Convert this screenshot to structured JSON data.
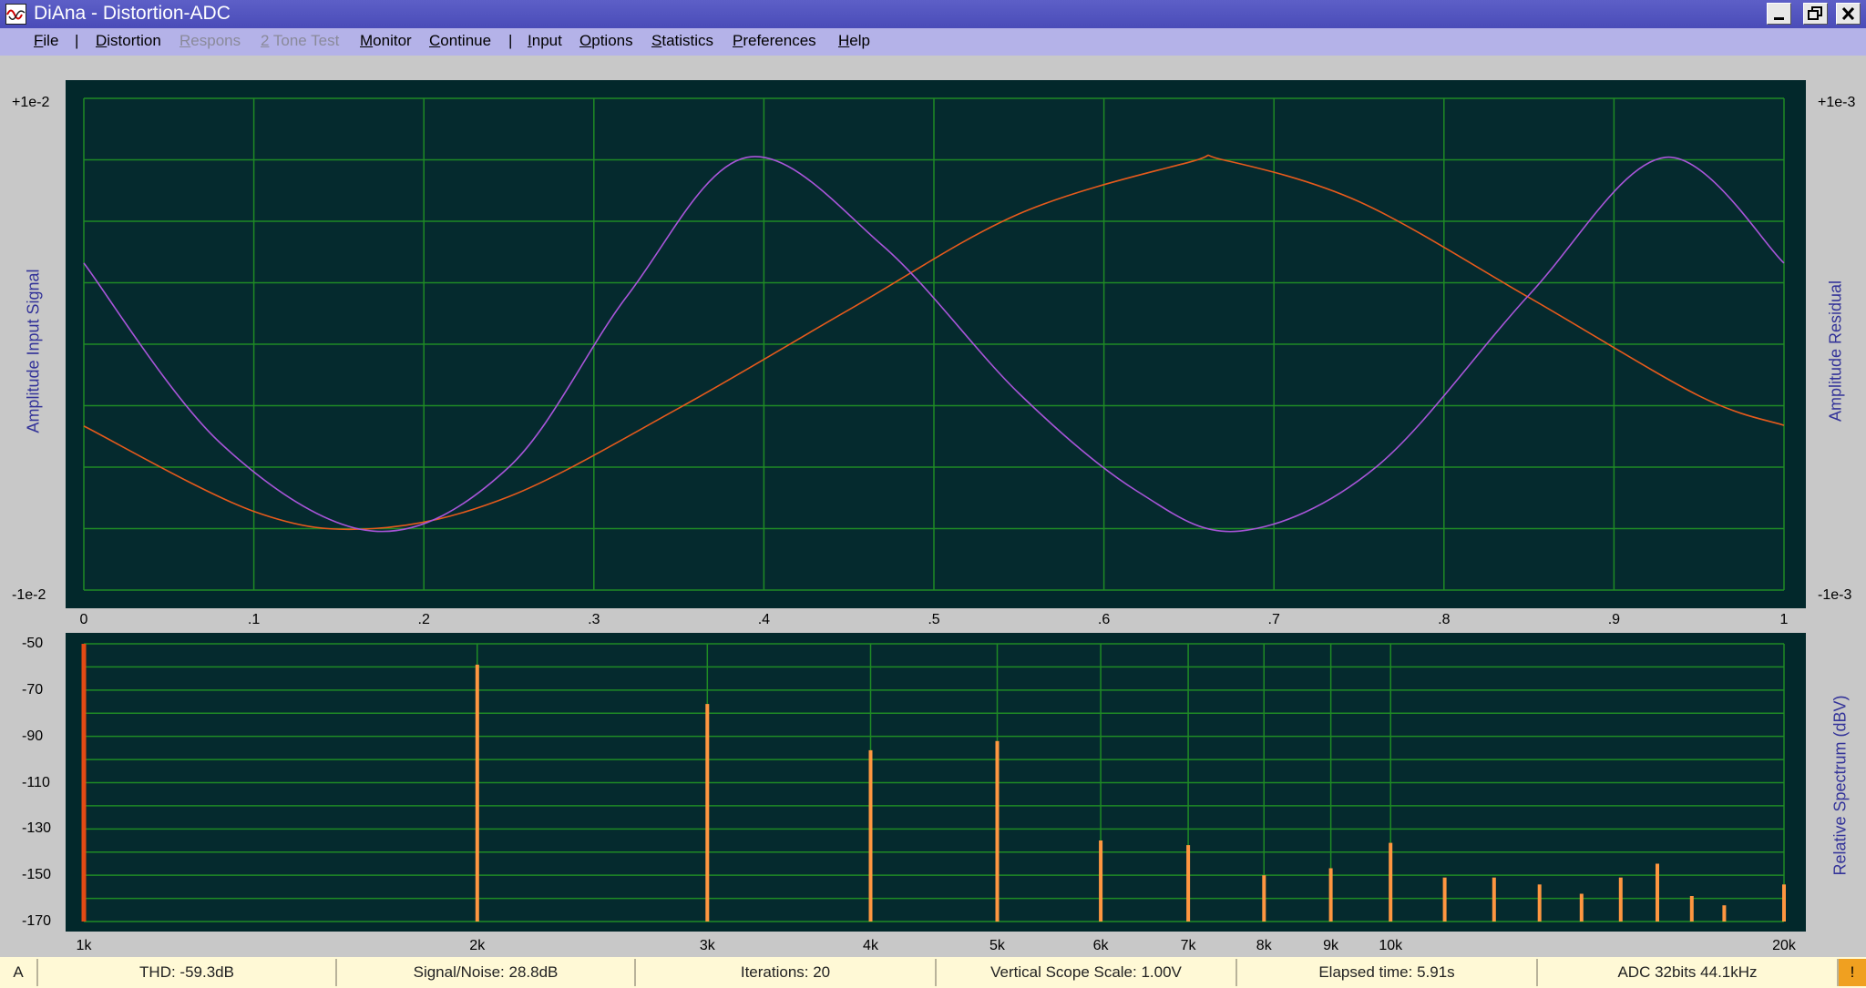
{
  "window": {
    "title": "DiAna - Distortion-ADC"
  },
  "menu": {
    "items": [
      {
        "label": "File",
        "enabled": true
      },
      {
        "label": "Distortion",
        "enabled": true
      },
      {
        "label": "Respons",
        "enabled": false
      },
      {
        "label": "2 Tone Test",
        "enabled": false
      },
      {
        "label": "Monitor",
        "enabled": true
      },
      {
        "label": "Continue",
        "enabled": true
      },
      {
        "label": "Input",
        "enabled": true
      },
      {
        "label": "Options",
        "enabled": true
      },
      {
        "label": "Statistics",
        "enabled": true
      },
      {
        "label": "Preferences",
        "enabled": true
      },
      {
        "label": "Help",
        "enabled": true
      }
    ],
    "separator": "|"
  },
  "scope": {
    "left_title": "Amplitude Input Signal",
    "right_title": "Amplitude Residual",
    "left_top": "+1e-2",
    "left_bottom": "-1e-2",
    "right_top": "+1e-3",
    "right_bottom": "-1e-3",
    "x_ticks": [
      "0",
      ".1",
      ".2",
      ".3",
      ".4",
      ".5",
      ".6",
      ".7",
      ".8",
      ".9",
      "1"
    ],
    "colors": {
      "background": "#052a2e",
      "grid": "#1f8a25",
      "input": "#e55a1c",
      "residual": "#a855d9"
    }
  },
  "spectrum": {
    "right_title": "Relative Spectrum (dBV)",
    "y_ticks": [
      "-50",
      "-70",
      "-90",
      "-110",
      "-130",
      "-150",
      "-170"
    ],
    "x_ticks": [
      "1k",
      "2k",
      "3k",
      "4k",
      "5k",
      "6k",
      "7k",
      "8k",
      "9k",
      "10k",
      "20k"
    ],
    "colors": {
      "background": "#052a2e",
      "grid": "#1f8a25",
      "bar": "#ff9640",
      "fundamental": "#e34a14"
    }
  },
  "chart_data": [
    {
      "type": "line",
      "x_range": [
        0,
        1
      ],
      "y_range_left": [
        -0.01,
        0.01
      ],
      "y_range_right": [
        -0.001,
        0.001
      ],
      "series": [
        {
          "x": [
            0,
            0.1,
            0.17,
            0.25,
            0.35,
            0.45,
            0.55,
            0.65,
            0.67,
            0.75,
            0.85,
            0.95,
            1.0
          ],
          "y": [
            -0.00333,
            -0.0068,
            -0.0075,
            -0.0062,
            -0.0026,
            0.0014,
            0.0053,
            0.0074,
            0.0075,
            0.0058,
            0.0019,
            -0.0021,
            -0.0033
          ]
        },
        {
          "x": [
            0,
            0.08,
            0.17,
            0.25,
            0.32,
            0.39,
            0.47,
            0.55,
            0.62,
            0.68,
            0.76,
            0.85,
            0.93,
            1.0
          ],
          "y": [
            0.00033,
            -0.0004,
            -0.00076,
            -0.0005,
            0.0002,
            0.00076,
            0.0004,
            -0.0002,
            -0.0006,
            -0.00076,
            -0.0005,
            0.0002,
            0.00076,
            0.00033
          ]
        }
      ]
    },
    {
      "type": "bar",
      "x_scale": "log",
      "ylim": [
        -170,
        -50
      ],
      "frequencies_hz": [
        1000,
        2000,
        3000,
        4000,
        5000,
        6000,
        7000,
        8000,
        9000,
        10000,
        11000,
        12000,
        13000,
        14000,
        15000,
        16000,
        17000,
        18000,
        20000
      ],
      "values_dbv": [
        -50,
        -59,
        -76,
        -96,
        -92,
        -135,
        -137,
        -150,
        -147,
        -136,
        -151,
        -151,
        -154,
        -158,
        -151,
        -145,
        -159,
        -163,
        -154
      ]
    }
  ],
  "status": {
    "mode": "A",
    "thd": "THD:  -59.3dB",
    "snr": "Signal/Noise:   28.8dB",
    "iterations": "Iterations: 20",
    "scope_scale": "Vertical Scope Scale: 1.00V",
    "elapsed": "Elapsed time: 5.91s",
    "adc": "ADC 32bits 44.1kHz",
    "warning": "!"
  }
}
